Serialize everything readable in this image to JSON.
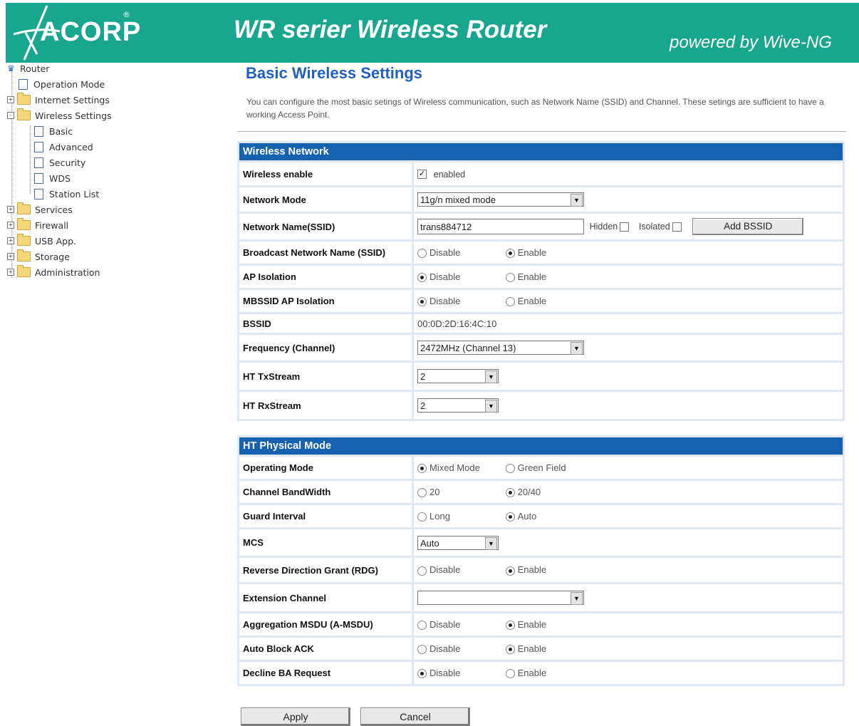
{
  "header": {
    "logo_text": "ACORP",
    "logo_mark": "®",
    "title": "WR serier Wireless Router",
    "powered": "powered by Wive-NG"
  },
  "sidebar": {
    "items": [
      {
        "label": "Router",
        "icon": "router-icon",
        "indent": 0
      },
      {
        "label": "Operation Mode",
        "icon": "page-icon",
        "indent": 1
      },
      {
        "label": "Internet Settings",
        "icon": "folder-icon",
        "indent": 1,
        "toggle": "+"
      },
      {
        "label": "Wireless Settings",
        "icon": "folder-open-icon",
        "indent": 1,
        "toggle": "-"
      },
      {
        "label": "Basic",
        "icon": "page-icon",
        "indent": 2
      },
      {
        "label": "Advanced",
        "icon": "page-icon",
        "indent": 2
      },
      {
        "label": "Security",
        "icon": "page-icon",
        "indent": 2
      },
      {
        "label": "WDS",
        "icon": "page-icon",
        "indent": 2
      },
      {
        "label": "Station List",
        "icon": "page-icon",
        "indent": 2
      },
      {
        "label": "Services",
        "icon": "folder-icon",
        "indent": 1,
        "toggle": "+"
      },
      {
        "label": "Firewall",
        "icon": "folder-icon",
        "indent": 1,
        "toggle": "+"
      },
      {
        "label": "USB App.",
        "icon": "folder-icon",
        "indent": 1,
        "toggle": "+"
      },
      {
        "label": "Storage",
        "icon": "folder-icon",
        "indent": 1,
        "toggle": "+"
      },
      {
        "label": "Administration",
        "icon": "folder-icon",
        "indent": 1,
        "toggle": "+"
      }
    ]
  },
  "main": {
    "title": "Basic Wireless Settings",
    "description": "You can configure the most basic setings of Wireless communication, such as Network Name (SSID) and Channel. These setings are sufficient to have a working Access Point."
  },
  "wireless": {
    "section_title": "Wireless Network",
    "enable_label": "Wireless enable",
    "enable_text": "enabled",
    "mode_label": "Network Mode",
    "mode_value": "11g/n mixed mode",
    "ssid_label": "Network Name(SSID)",
    "ssid_value": "trans884712",
    "hidden_label": "Hidden",
    "isolated_label": "Isolated",
    "add_bssid": "Add BSSID",
    "broadcast_label": "Broadcast Network Name (SSID)",
    "ap_isolation_label": "AP Isolation",
    "mbssid_label": "MBSSID AP Isolation",
    "bssid_label": "BSSID",
    "bssid_value": "00:0D:2D:16:4C:10",
    "freq_label": "Frequency (Channel)",
    "freq_value": "2472MHz (Channel 13)",
    "tx_label": "HT TxStream",
    "tx_value": "2",
    "rx_label": "HT RxStream",
    "rx_value": "2",
    "disable": "Disable",
    "enable": "Enable"
  },
  "ht": {
    "section_title": "HT Physical Mode",
    "op_label": "Operating Mode",
    "op_mixed": "Mixed Mode",
    "op_green": "Green Field",
    "bw_label": "Channel BandWidth",
    "bw_20": "20",
    "bw_2040": "20/40",
    "gi_label": "Guard Interval",
    "gi_long": "Long",
    "gi_auto": "Auto",
    "mcs_label": "MCS",
    "mcs_value": "Auto",
    "rdg_label": "Reverse Direction Grant (RDG)",
    "ext_label": "Extension Channel",
    "ext_value": "",
    "amsdu_label": "Aggregation MSDU (A-MSDU)",
    "ack_label": "Auto Block ACK",
    "ba_label": "Decline BA Request",
    "disable": "Disable",
    "enable": "Enable"
  },
  "buttons": {
    "apply": "Apply",
    "cancel": "Cancel"
  },
  "colors": {
    "header_bg": "#19a68f",
    "section_bg": "#1661b0",
    "title": "#1f5fbf"
  }
}
